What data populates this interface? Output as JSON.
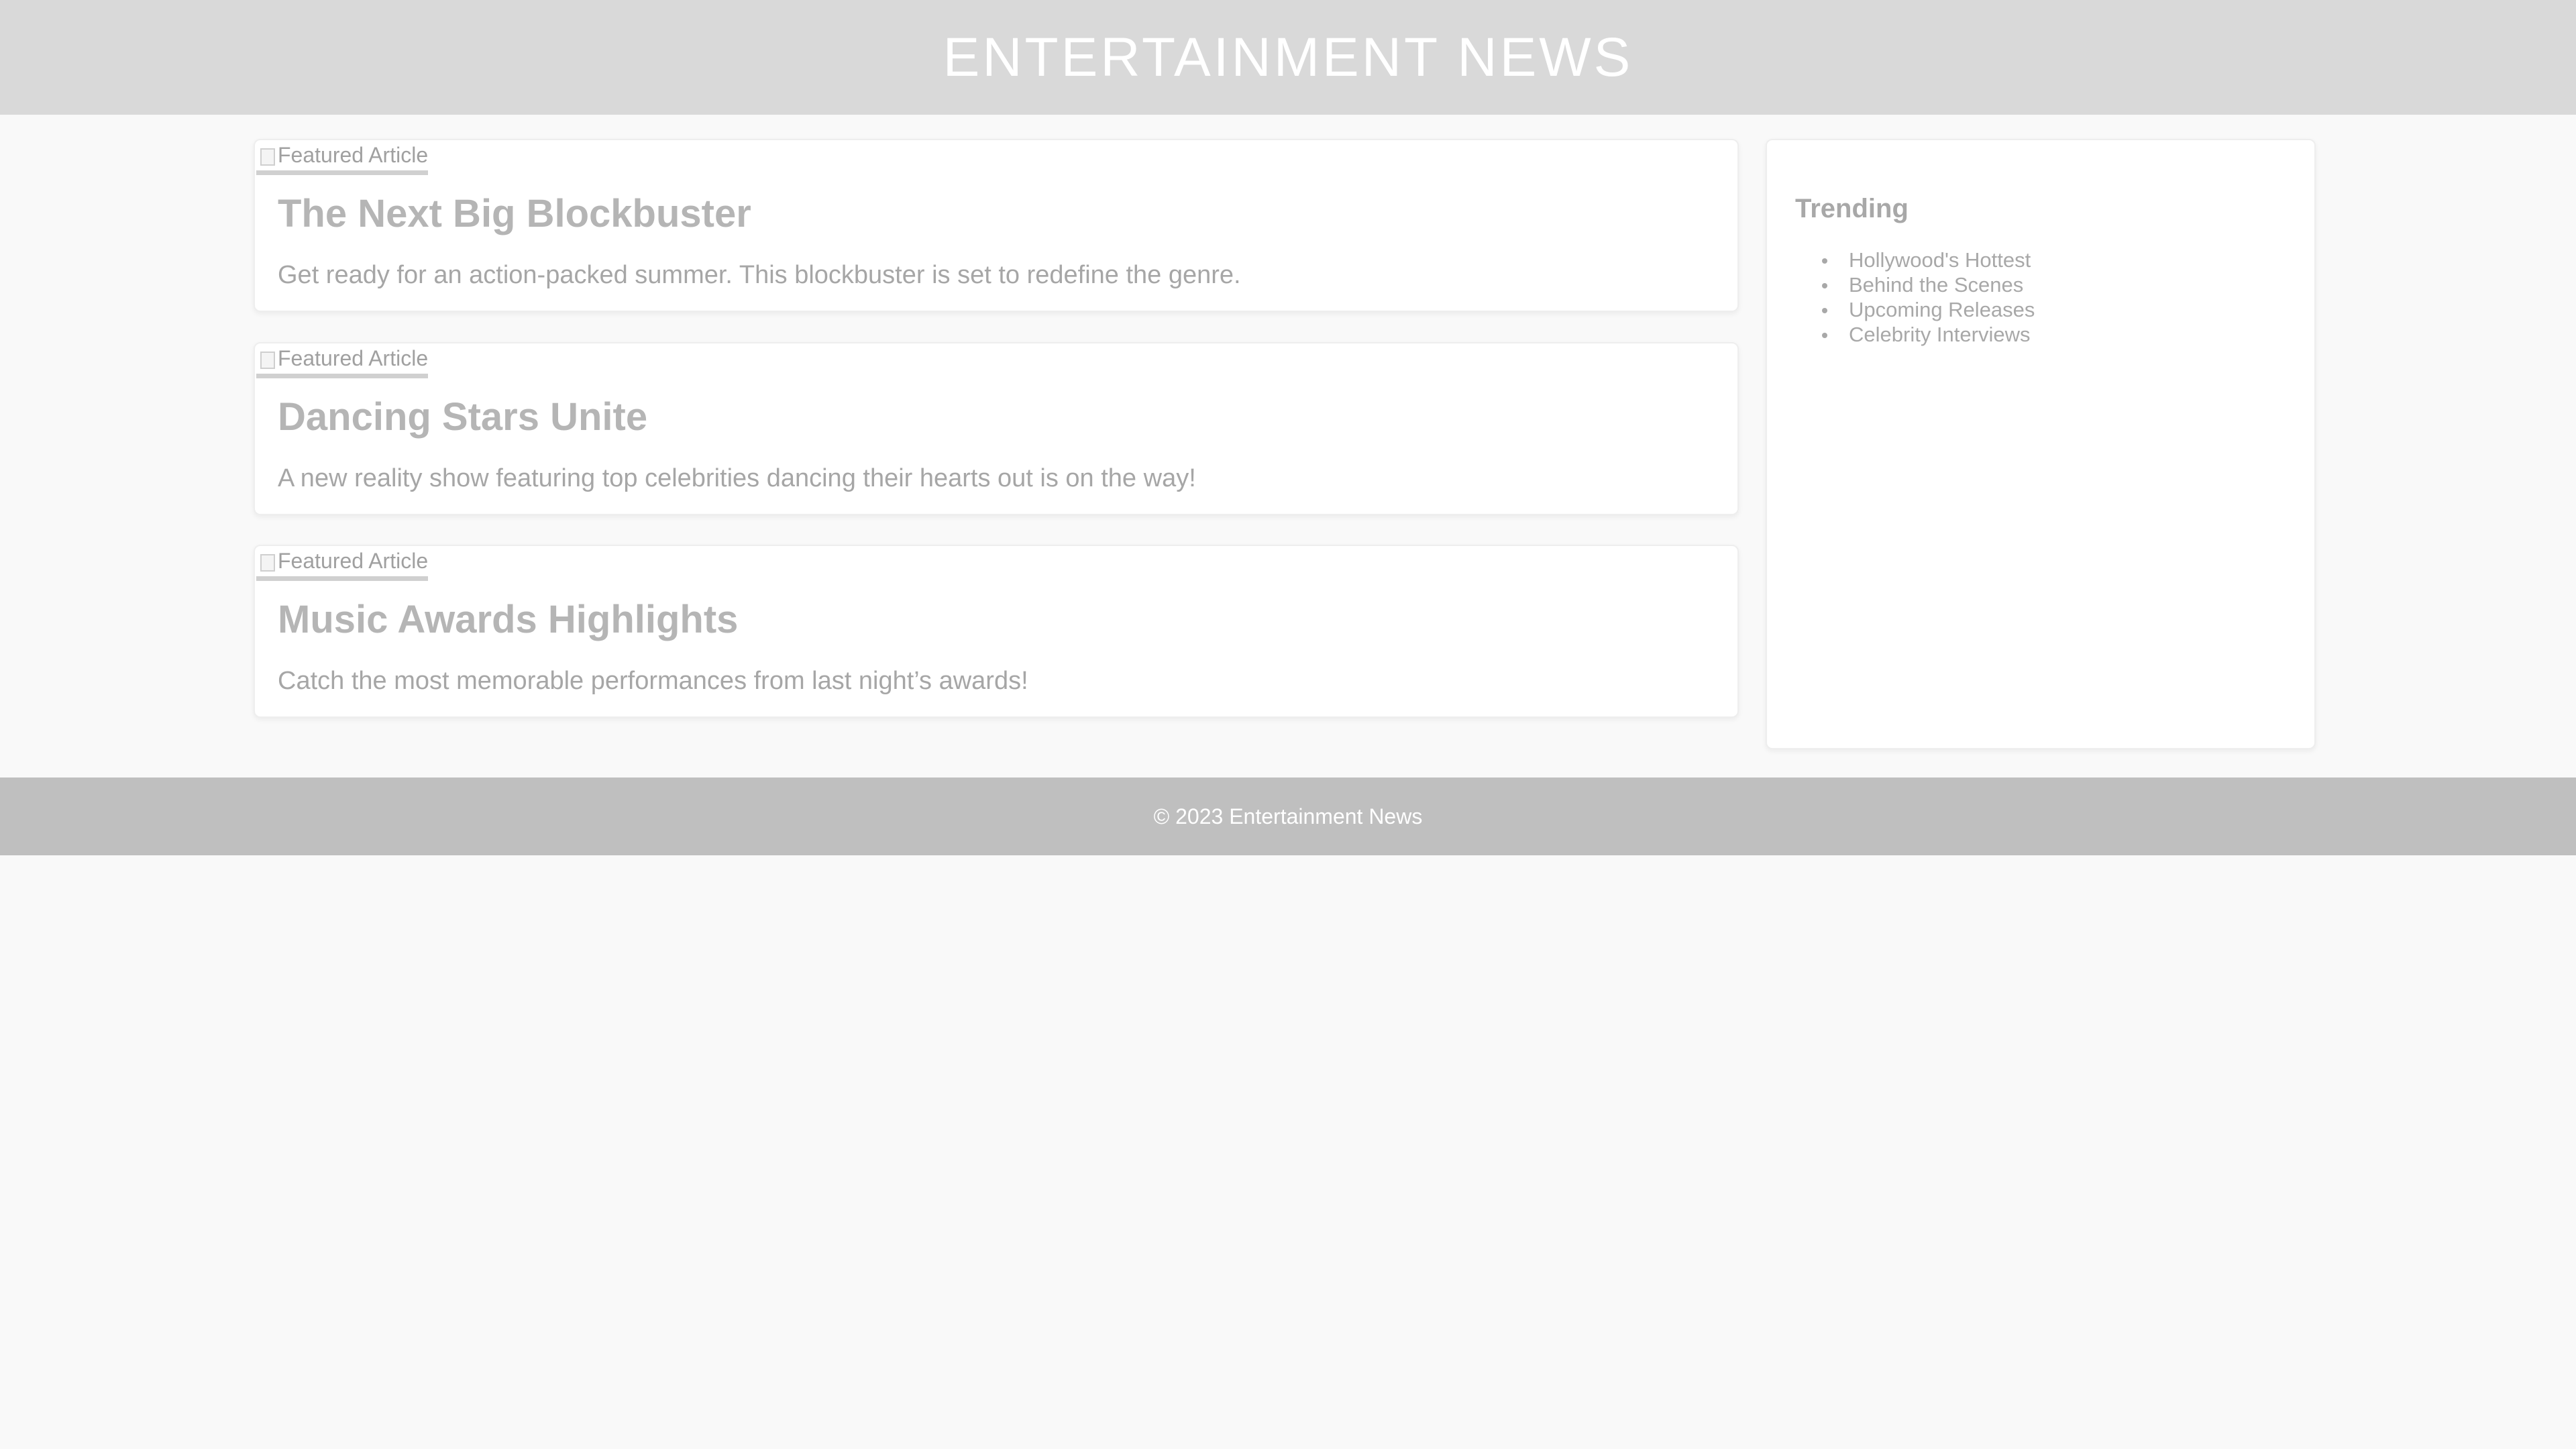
{
  "header": {
    "title": "ENTERTAINMENT NEWS"
  },
  "articles": [
    {
      "image_alt": "Featured Article",
      "title": "The Next Big Blockbuster",
      "description": "Get ready for an action-packed summer. This blockbuster is set to redefine the genre."
    },
    {
      "image_alt": "Featured Article",
      "title": "Dancing Stars Unite",
      "description": "A new reality show featuring top celebrities dancing their hearts out is on the way!"
    },
    {
      "image_alt": "Featured Article",
      "title": "Music Awards Highlights",
      "description": "Catch the most memorable performances from last night’s awards!"
    }
  ],
  "sidebar": {
    "title": "Trending",
    "items": [
      "Hollywood's Hottest",
      "Behind the Scenes",
      "Upcoming Releases",
      "Celebrity Interviews"
    ]
  },
  "footer": {
    "text": "© 2023 Entertainment News"
  },
  "colors": {
    "header_bg": "#d9d9d9",
    "footer_bg": "#bfbfbf",
    "page_bg": "#f9f9f9",
    "card_bg": "#ffffff"
  }
}
